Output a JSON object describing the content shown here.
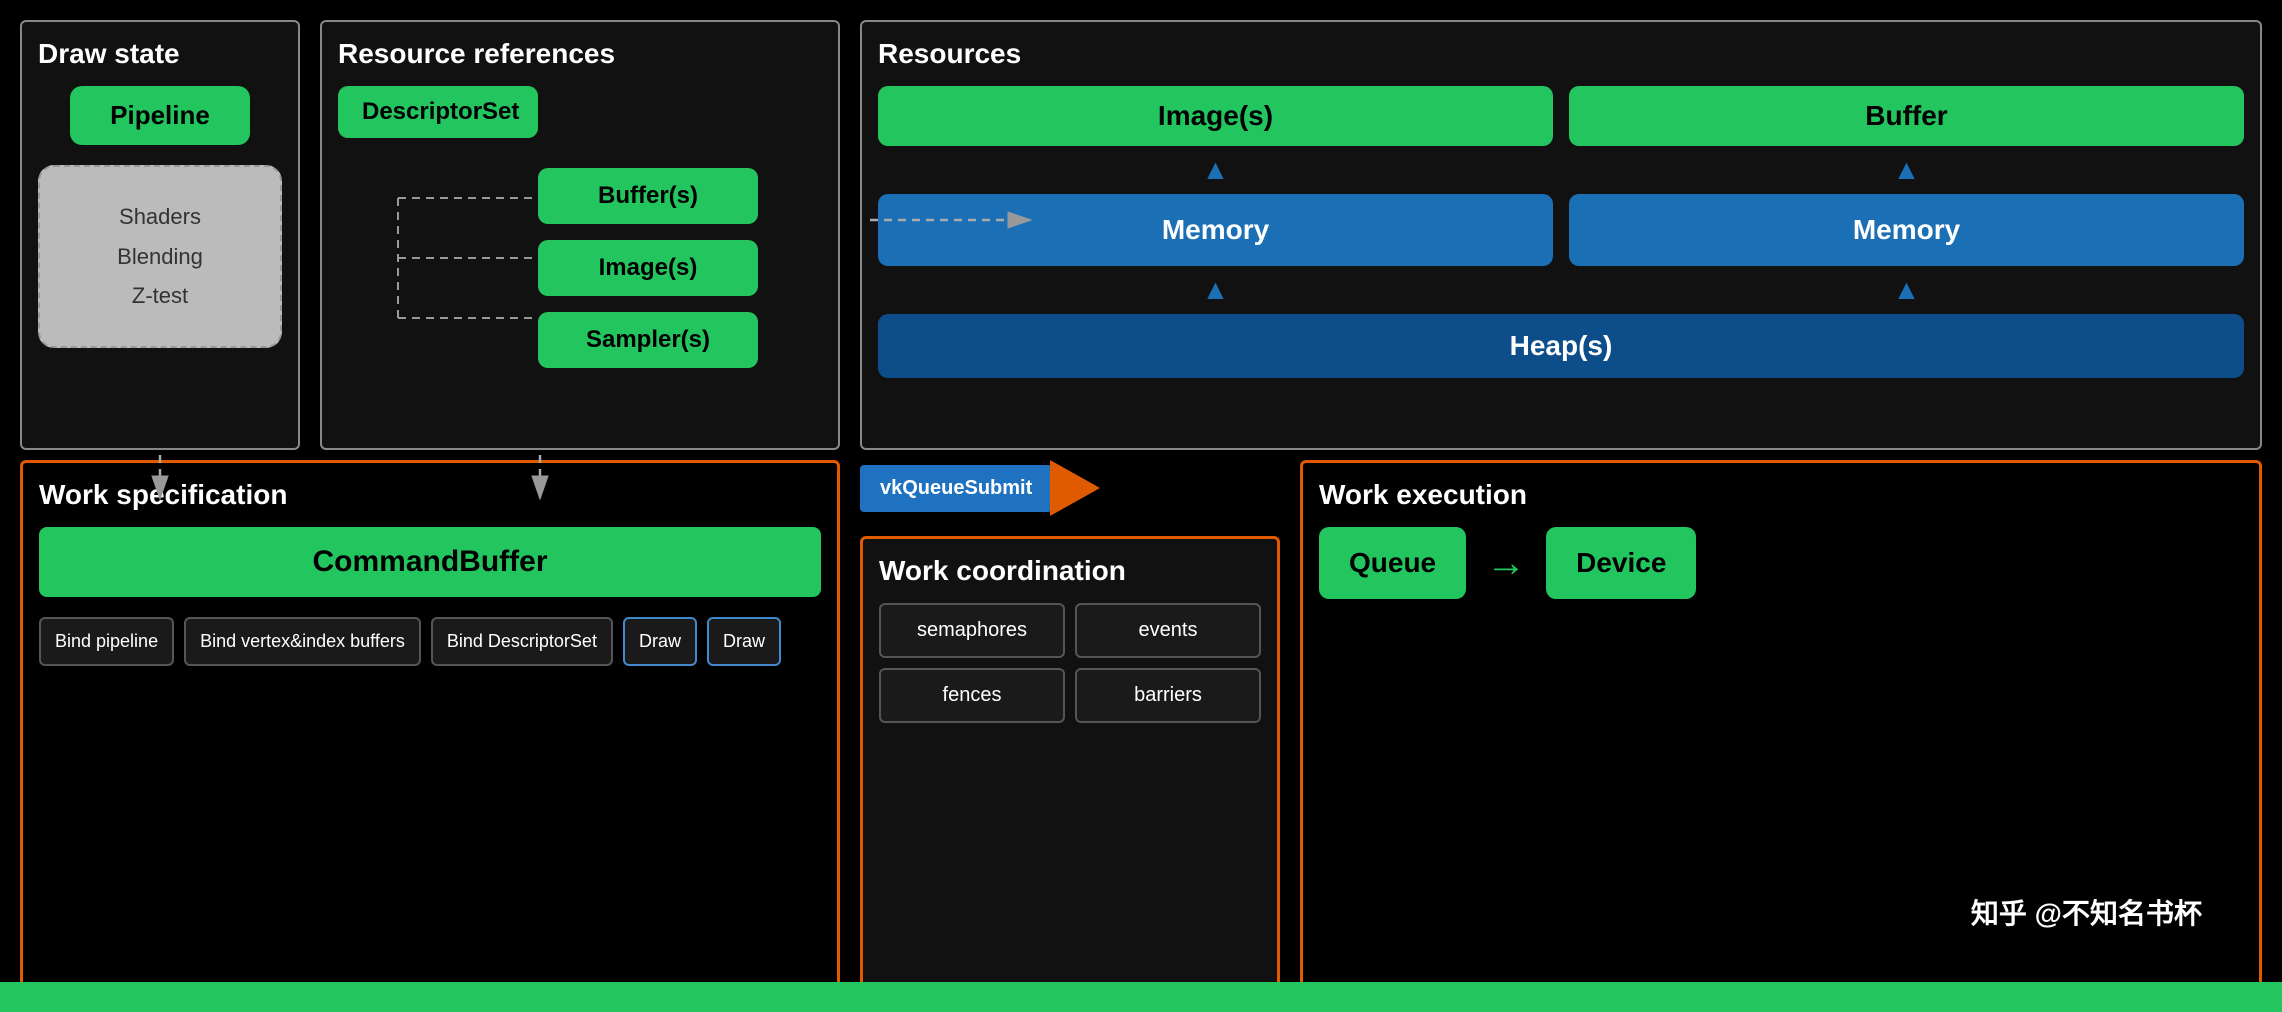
{
  "background": "#000",
  "top_row": {
    "draw_state": {
      "title": "Draw state",
      "pipeline": "Pipeline",
      "shaders_content": "Shaders\nBlending\nZ-test"
    },
    "resource_refs": {
      "title": "Resource references",
      "descriptor_set": "DescriptorSet",
      "items": [
        "Buffer(s)",
        "Image(s)",
        "Sampler(s)"
      ]
    },
    "resources": {
      "title": "Resources",
      "image": "Image(s)",
      "buffer": "Buffer",
      "memory1": "Memory",
      "memory2": "Memory",
      "heap": "Heap(s)"
    }
  },
  "bottom_row": {
    "work_spec": {
      "title": "Work specification",
      "command_buffer": "CommandBuffer",
      "items": [
        "Bind pipeline",
        "Bind vertex&index buffers",
        "Bind DescriptorSet",
        "Draw",
        "Draw"
      ]
    },
    "vk_submit": "vkQueueSubmit",
    "work_coord": {
      "title": "Work coordination",
      "items": [
        "semaphores",
        "events",
        "fences",
        "barriers"
      ]
    },
    "work_exec": {
      "title": "Work execution",
      "queue": "Queue",
      "arrow": "→",
      "device": "Device"
    }
  },
  "watermark": "知乎 @不知名书杯"
}
